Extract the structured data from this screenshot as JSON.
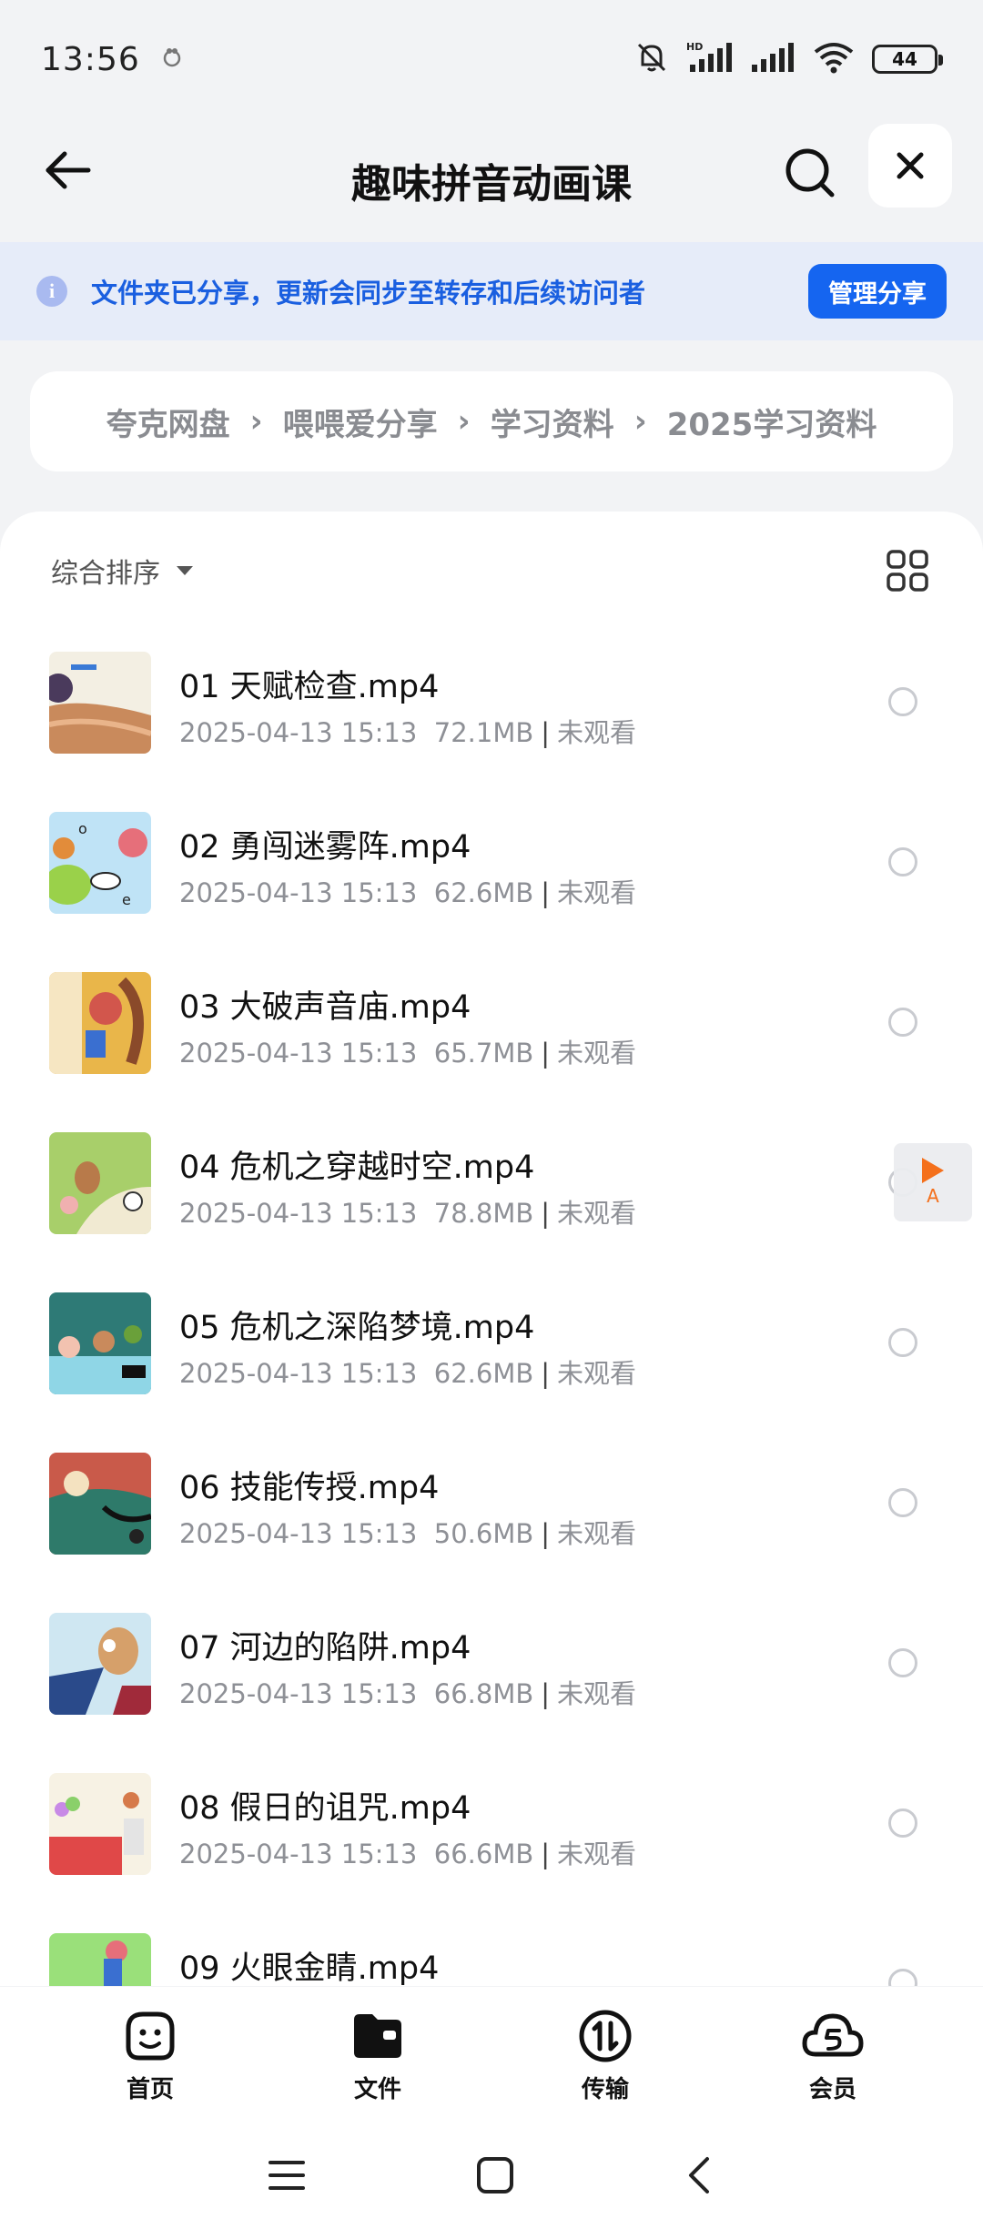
{
  "status_bar": {
    "time": "13:56",
    "battery": "44",
    "icons": [
      "silent-bell-icon",
      "hd-signal-icon",
      "signal-icon",
      "wifi-icon"
    ]
  },
  "header": {
    "title": "趣味拼音动画课"
  },
  "banner": {
    "text": "文件夹已分享，更新会同步至转存和后续访问者",
    "button": "管理分享"
  },
  "breadcrumb": {
    "items": [
      "夸克网盘",
      "喂喂爱分享",
      "学习资料",
      "2025学习资料"
    ]
  },
  "sort": {
    "label": "综合排序"
  },
  "files": [
    {
      "name": "01 天赋检查.mp4",
      "date": "2025-04-13 15:13",
      "size": "72.1MB",
      "status": "未观看"
    },
    {
      "name": "02 勇闯迷雾阵.mp4",
      "date": "2025-04-13 15:13",
      "size": "62.6MB",
      "status": "未观看"
    },
    {
      "name": "03 大破声音庙.mp4",
      "date": "2025-04-13 15:13",
      "size": "65.7MB",
      "status": "未观看"
    },
    {
      "name": "04 危机之穿越时空.mp4",
      "date": "2025-04-13 15:13",
      "size": "78.8MB",
      "status": "未观看"
    },
    {
      "name": "05 危机之深陷梦境.mp4",
      "date": "2025-04-13 15:13",
      "size": "62.6MB",
      "status": "未观看"
    },
    {
      "name": "06 技能传授.mp4",
      "date": "2025-04-13 15:13",
      "size": "50.6MB",
      "status": "未观看"
    },
    {
      "name": "07 河边的陷阱.mp4",
      "date": "2025-04-13 15:13",
      "size": "66.8MB",
      "status": "未观看"
    },
    {
      "name": "08 假日的诅咒.mp4",
      "date": "2025-04-13 15:13",
      "size": "66.6MB",
      "status": "未观看"
    },
    {
      "name": "09 火眼金睛.mp4",
      "date": "",
      "size": "",
      "status": ""
    }
  ],
  "float_button": {
    "label": "A"
  },
  "bottom_nav": {
    "items": [
      {
        "label": "首页",
        "icon": "smiley-home-icon"
      },
      {
        "label": "文件",
        "icon": "folder-icon"
      },
      {
        "label": "传输",
        "icon": "transfer-icon"
      },
      {
        "label": "会员",
        "icon": "member-cloud-icon"
      }
    ]
  },
  "colors": {
    "accent": "#1565f0",
    "banner_bg": "#e6ecf9",
    "float_play": "#f4701c"
  }
}
